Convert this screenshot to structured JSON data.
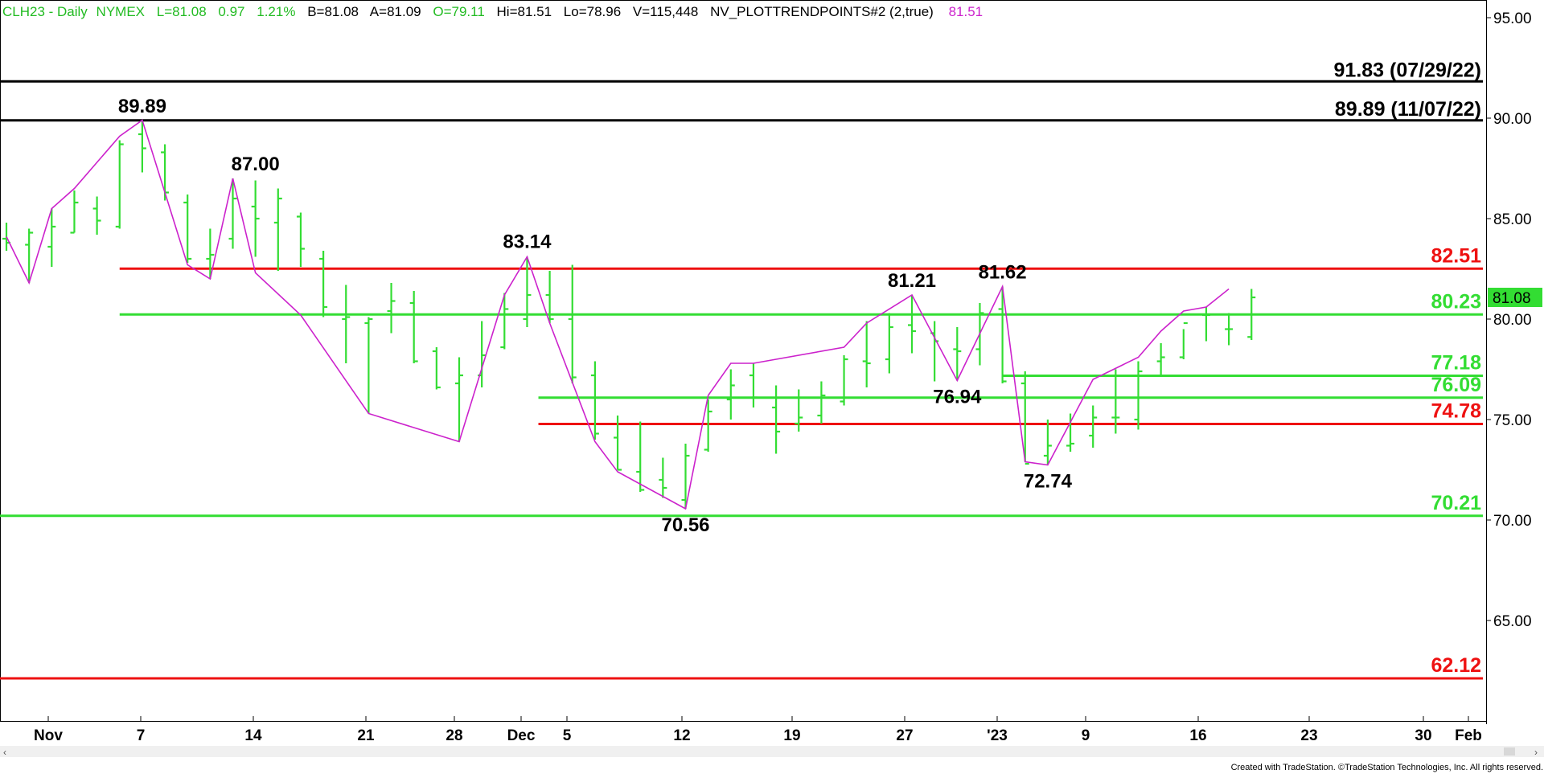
{
  "header": {
    "symbol": "CLH23 - Daily",
    "exchange": "NYMEX",
    "last": "L=81.08",
    "change": "0.97",
    "change_pct": "1.21%",
    "bid": "B=81.08",
    "ask": "A=81.09",
    "open": "O=79.11",
    "high": "Hi=81.51",
    "low": "Lo=78.96",
    "volume": "V=115,448",
    "study": "NV_PLOTTRENDPOINTS#2 (2,true)",
    "study_value": "81.51"
  },
  "colors": {
    "bar": "#33dd33",
    "trend": "#cc22cc",
    "support": "#33dd33",
    "resistance": "#ee1111",
    "historic": "#000000",
    "header_green": "#22bb22",
    "header_magenta": "#cc22cc",
    "last_badge_bg": "#33dd33"
  },
  "footer": {
    "credit": "Created with TradeStation. ©TradeStation Technologies, Inc. All rights reserved."
  },
  "chart_data": {
    "type": "ohlc",
    "y_axis": {
      "ticks": [
        "95.00",
        "90.00",
        "85.00",
        "80.00",
        "75.00",
        "70.00",
        "65.00"
      ],
      "ylim": [
        60.0,
        95.8
      ]
    },
    "x_axis": {
      "tick_labels": [
        "Nov",
        "7",
        "14",
        "21",
        "28",
        "Dec",
        "5",
        "12",
        "19",
        "27",
        "'23",
        "9",
        "16",
        "23",
        "30",
        "Feb"
      ]
    },
    "last_price_badge": "81.08",
    "historic_levels": [
      {
        "value": 91.83,
        "label": "91.83 (07/29/22)"
      },
      {
        "value": 89.89,
        "label": "89.89 (11/07/22)"
      }
    ],
    "levels": [
      {
        "value": 82.51,
        "label": "82.51",
        "kind": "resistance"
      },
      {
        "value": 80.23,
        "label": "80.23",
        "kind": "support"
      },
      {
        "value": 77.18,
        "label": "77.18",
        "kind": "support"
      },
      {
        "value": 76.09,
        "label": "76.09",
        "kind": "support"
      },
      {
        "value": 74.78,
        "label": "74.78",
        "kind": "resistance"
      },
      {
        "value": 70.21,
        "label": "70.21",
        "kind": "support"
      },
      {
        "value": 62.12,
        "label": "62.12",
        "kind": "resistance"
      }
    ],
    "trend_points": [
      {
        "label": "89.89",
        "value": 89.89
      },
      {
        "label": "87.00",
        "value": 87.0
      },
      {
        "label": "83.14",
        "value": 83.14
      },
      {
        "label": "81.21",
        "value": 81.21
      },
      {
        "label": "81.62",
        "value": 81.62
      },
      {
        "label": "76.94",
        "value": 76.94
      },
      {
        "label": "72.74",
        "value": 72.74
      },
      {
        "label": "70.56",
        "value": 70.56
      }
    ],
    "trend_line": [
      84.1,
      81.8,
      85.5,
      86.5,
      89.1,
      89.9,
      82.7,
      82.0,
      87.0,
      82.3,
      80.2,
      75.3,
      73.9,
      81.2,
      83.1,
      79.8,
      73.9,
      72.4,
      70.56,
      76.2,
      77.8,
      77.8,
      78.6,
      79.8,
      81.2,
      76.94,
      81.62,
      72.9,
      72.74,
      77.0,
      78.1,
      79.4,
      80.4,
      80.6,
      81.5
    ],
    "bars": [
      {
        "date": "10/28",
        "h": 84.8,
        "l": 83.4,
        "o": 84.0,
        "c": 83.8
      },
      {
        "date": "10/31",
        "h": 84.5,
        "l": 81.8,
        "o": 83.7,
        "c": 84.3
      },
      {
        "date": "11/01",
        "h": 85.5,
        "l": 82.6,
        "o": 83.6,
        "c": 84.6
      },
      {
        "date": "11/02",
        "h": 86.4,
        "l": 84.3,
        "o": 84.3,
        "c": 85.8
      },
      {
        "date": "11/03",
        "h": 86.1,
        "l": 84.2,
        "o": 85.5,
        "c": 84.9
      },
      {
        "date": "11/04",
        "h": 88.9,
        "l": 84.5,
        "o": 84.6,
        "c": 88.7
      },
      {
        "date": "11/07",
        "h": 89.9,
        "l": 87.3,
        "o": 89.2,
        "c": 88.5
      },
      {
        "date": "11/08",
        "h": 88.7,
        "l": 85.9,
        "o": 88.3,
        "c": 86.3
      },
      {
        "date": "11/09",
        "h": 86.2,
        "l": 82.8,
        "o": 85.8,
        "c": 83.0
      },
      {
        "date": "11/10",
        "h": 84.5,
        "l": 82.0,
        "o": 83.0,
        "c": 83.2
      },
      {
        "date": "11/11",
        "h": 87.0,
        "l": 83.5,
        "o": 84.0,
        "c": 86.0
      },
      {
        "date": "11/14",
        "h": 86.9,
        "l": 83.1,
        "o": 85.6,
        "c": 85.0
      },
      {
        "date": "11/15",
        "h": 86.5,
        "l": 82.4,
        "o": 84.8,
        "c": 86.0
      },
      {
        "date": "11/16",
        "h": 85.3,
        "l": 82.6,
        "o": 85.1,
        "c": 83.5
      },
      {
        "date": "11/17",
        "h": 83.4,
        "l": 80.1,
        "o": 83.0,
        "c": 80.6
      },
      {
        "date": "11/18",
        "h": 81.7,
        "l": 77.8,
        "o": 80.0,
        "c": 80.1
      },
      {
        "date": "11/21",
        "h": 80.1,
        "l": 75.3,
        "o": 79.8,
        "c": 80.0
      },
      {
        "date": "11/22",
        "h": 81.8,
        "l": 79.3,
        "o": 80.4,
        "c": 80.9
      },
      {
        "date": "11/23",
        "h": 81.4,
        "l": 77.8,
        "o": 80.8,
        "c": 77.9
      },
      {
        "date": "11/25",
        "h": 78.6,
        "l": 76.5,
        "o": 78.4,
        "c": 76.6
      },
      {
        "date": "11/28",
        "h": 78.1,
        "l": 73.9,
        "o": 76.8,
        "c": 77.2
      },
      {
        "date": "11/29",
        "h": 79.9,
        "l": 76.6,
        "o": 77.2,
        "c": 78.2
      },
      {
        "date": "11/30",
        "h": 81.3,
        "l": 78.5,
        "o": 78.6,
        "c": 80.5
      },
      {
        "date": "12/01",
        "h": 83.1,
        "l": 79.6,
        "o": 80.0,
        "c": 81.2
      },
      {
        "date": "12/02",
        "h": 82.4,
        "l": 79.8,
        "o": 81.2,
        "c": 80.0
      },
      {
        "date": "12/05",
        "h": 82.7,
        "l": 76.8,
        "o": 80.0,
        "c": 77.1
      },
      {
        "date": "12/06",
        "h": 77.9,
        "l": 74.0,
        "o": 77.2,
        "c": 74.3
      },
      {
        "date": "12/07",
        "h": 75.2,
        "l": 72.5,
        "o": 74.1,
        "c": 72.5
      },
      {
        "date": "12/08",
        "h": 74.9,
        "l": 71.4,
        "o": 72.4,
        "c": 71.5
      },
      {
        "date": "12/09",
        "h": 73.1,
        "l": 71.1,
        "o": 72.0,
        "c": 71.6
      },
      {
        "date": "12/12",
        "h": 73.8,
        "l": 70.56,
        "o": 71.0,
        "c": 73.2
      },
      {
        "date": "12/13",
        "h": 76.0,
        "l": 73.4,
        "o": 73.5,
        "c": 75.4
      },
      {
        "date": "12/14",
        "h": 77.5,
        "l": 75.0,
        "o": 76.0,
        "c": 76.7
      },
      {
        "date": "12/15",
        "h": 77.8,
        "l": 75.6,
        "o": 77.2,
        "c": 76.1
      },
      {
        "date": "12/16",
        "h": 76.7,
        "l": 73.3,
        "o": 75.6,
        "c": 74.4
      },
      {
        "date": "12/19",
        "h": 76.5,
        "l": 74.4,
        "o": 74.8,
        "c": 75.1
      },
      {
        "date": "12/20",
        "h": 76.9,
        "l": 74.8,
        "o": 75.2,
        "c": 76.2
      },
      {
        "date": "12/21",
        "h": 78.2,
        "l": 75.7,
        "o": 75.9,
        "c": 78.0
      },
      {
        "date": "12/22",
        "h": 79.9,
        "l": 76.6,
        "o": 77.9,
        "c": 77.8
      },
      {
        "date": "12/23",
        "h": 80.3,
        "l": 77.3,
        "o": 78.0,
        "c": 79.6
      },
      {
        "date": "12/27",
        "h": 81.21,
        "l": 78.3,
        "o": 79.7,
        "c": 79.4
      },
      {
        "date": "12/28",
        "h": 79.9,
        "l": 76.9,
        "o": 79.3,
        "c": 78.9
      },
      {
        "date": "12/29",
        "h": 79.6,
        "l": 76.94,
        "o": 78.5,
        "c": 78.4
      },
      {
        "date": "12/30",
        "h": 80.8,
        "l": 77.7,
        "o": 78.5,
        "c": 80.3
      },
      {
        "date": "01/03",
        "h": 81.62,
        "l": 76.8,
        "o": 80.5,
        "c": 76.9
      },
      {
        "date": "01/04",
        "h": 77.4,
        "l": 72.9,
        "o": 76.8,
        "c": 72.8
      },
      {
        "date": "01/05",
        "h": 75.0,
        "l": 72.74,
        "o": 73.2,
        "c": 73.7
      },
      {
        "date": "01/06",
        "h": 75.3,
        "l": 73.4,
        "o": 73.7,
        "c": 73.8
      },
      {
        "date": "01/09",
        "h": 75.7,
        "l": 73.6,
        "o": 74.2,
        "c": 75.1
      },
      {
        "date": "01/10",
        "h": 77.5,
        "l": 74.3,
        "o": 75.1,
        "c": 75.1
      },
      {
        "date": "01/11",
        "h": 77.9,
        "l": 74.5,
        "o": 75.0,
        "c": 77.4
      },
      {
        "date": "01/12",
        "h": 78.8,
        "l": 77.2,
        "o": 77.9,
        "c": 78.1
      },
      {
        "date": "01/13",
        "h": 79.5,
        "l": 78.0,
        "o": 78.1,
        "c": 79.8
      },
      {
        "date": "01/17",
        "h": 80.6,
        "l": 78.9,
        "o": 80.2,
        "c": 80.2
      },
      {
        "date": "01/18",
        "h": 80.3,
        "l": 78.7,
        "o": 79.5,
        "c": 79.5
      },
      {
        "date": "01/19",
        "h": 81.5,
        "l": 78.96,
        "o": 79.11,
        "c": 81.08
      }
    ]
  }
}
